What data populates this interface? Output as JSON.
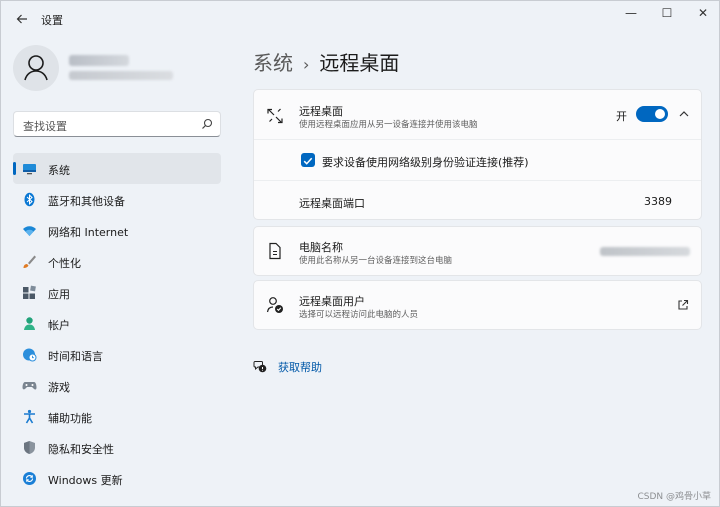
{
  "window": {
    "app_title": "设置",
    "controls": {
      "minimize": "—",
      "maximize": "☐",
      "close": "✕"
    }
  },
  "sidebar": {
    "search": {
      "placeholder": "查找设置"
    },
    "items": [
      {
        "label": "系统",
        "icon": "monitor-icon",
        "active": true
      },
      {
        "label": "蓝牙和其他设备",
        "icon": "bluetooth-icon"
      },
      {
        "label": "网络和 Internet",
        "icon": "wifi-icon"
      },
      {
        "label": "个性化",
        "icon": "brush-icon"
      },
      {
        "label": "应用",
        "icon": "apps-icon"
      },
      {
        "label": "帐户",
        "icon": "account-icon"
      },
      {
        "label": "时间和语言",
        "icon": "globe-clock-icon"
      },
      {
        "label": "游戏",
        "icon": "gamepad-icon"
      },
      {
        "label": "辅助功能",
        "icon": "accessibility-icon"
      },
      {
        "label": "隐私和安全性",
        "icon": "shield-icon"
      },
      {
        "label": "Windows 更新",
        "icon": "update-icon"
      }
    ]
  },
  "breadcrumb": {
    "parent": "系统",
    "separator": "›",
    "current": "远程桌面"
  },
  "remote_desktop": {
    "title": "远程桌面",
    "description": "使用远程桌面应用从另一设备连接并使用该电脑",
    "toggle_label": "开",
    "toggle_on": true,
    "nla_checkbox_label": "要求设备使用网络级别身份验证连接(推荐)",
    "nla_checked": true,
    "port_label": "远程桌面端口",
    "port_value": "3389"
  },
  "pc_name": {
    "title": "电脑名称",
    "description": "使用此名称从另一台设备连接到这台电脑"
  },
  "rd_users": {
    "title": "远程桌面用户",
    "description": "选择可以远程访问此电脑的人员"
  },
  "help": {
    "label": "获取帮助"
  },
  "watermark": "CSDN @鸡骨小草",
  "colors": {
    "accent": "#0067c0",
    "link": "#0058a8",
    "background": "#eef2f7"
  }
}
